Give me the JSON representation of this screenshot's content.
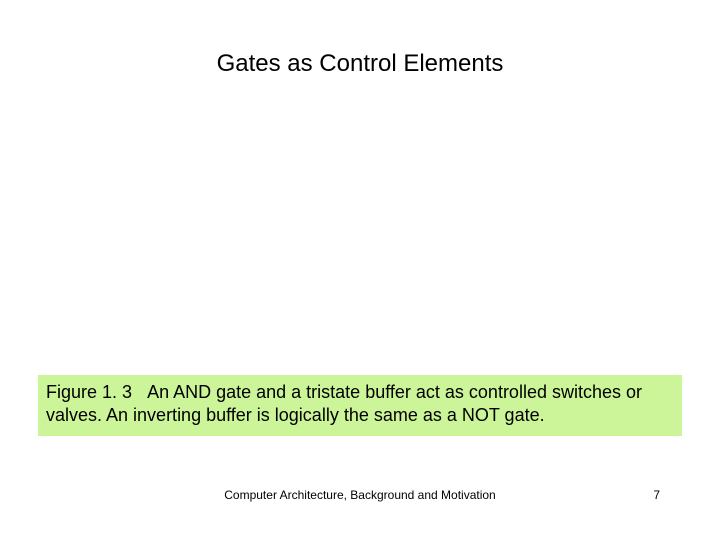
{
  "title": "Gates as Control Elements",
  "caption": {
    "label": "Figure 1. 3",
    "text": "An AND gate and a tristate buffer act as controlled switches or valves. An inverting buffer is logically the same as a NOT gate."
  },
  "footer": "Computer Architecture, Background and Motivation",
  "page": "7"
}
